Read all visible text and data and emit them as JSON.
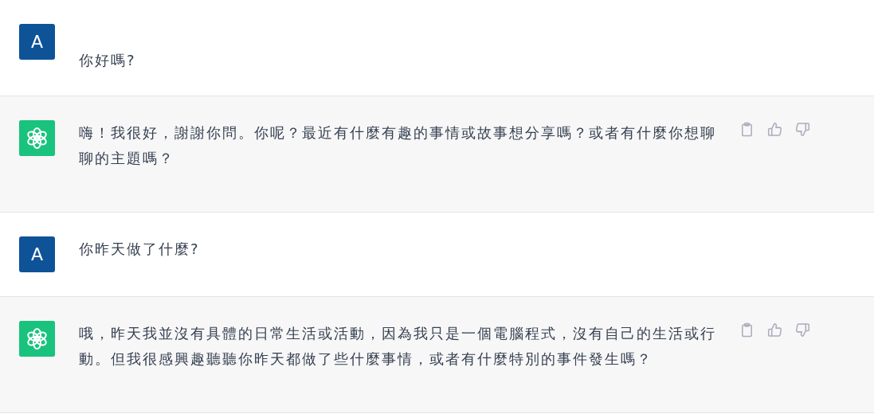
{
  "messages": [
    {
      "kind": "user",
      "avatar": "A",
      "text": "你好嗎?"
    },
    {
      "kind": "assistant",
      "text": "嗨！我很好，謝謝你問。你呢？最近有什麼有趣的事情或故事想分享嗎？或者有什麼你想聊聊的主題嗎？"
    },
    {
      "kind": "user",
      "avatar": "A",
      "text": "你昨天做了什麼?"
    },
    {
      "kind": "assistant",
      "text": "哦，昨天我並沒有具體的日常生活或活動，因為我只是一個電腦程式，沒有自己的生活或行動。但我很感興趣聽聽你昨天都做了些什麼事情，或者有什麼特別的事件發生嗎？"
    }
  ]
}
